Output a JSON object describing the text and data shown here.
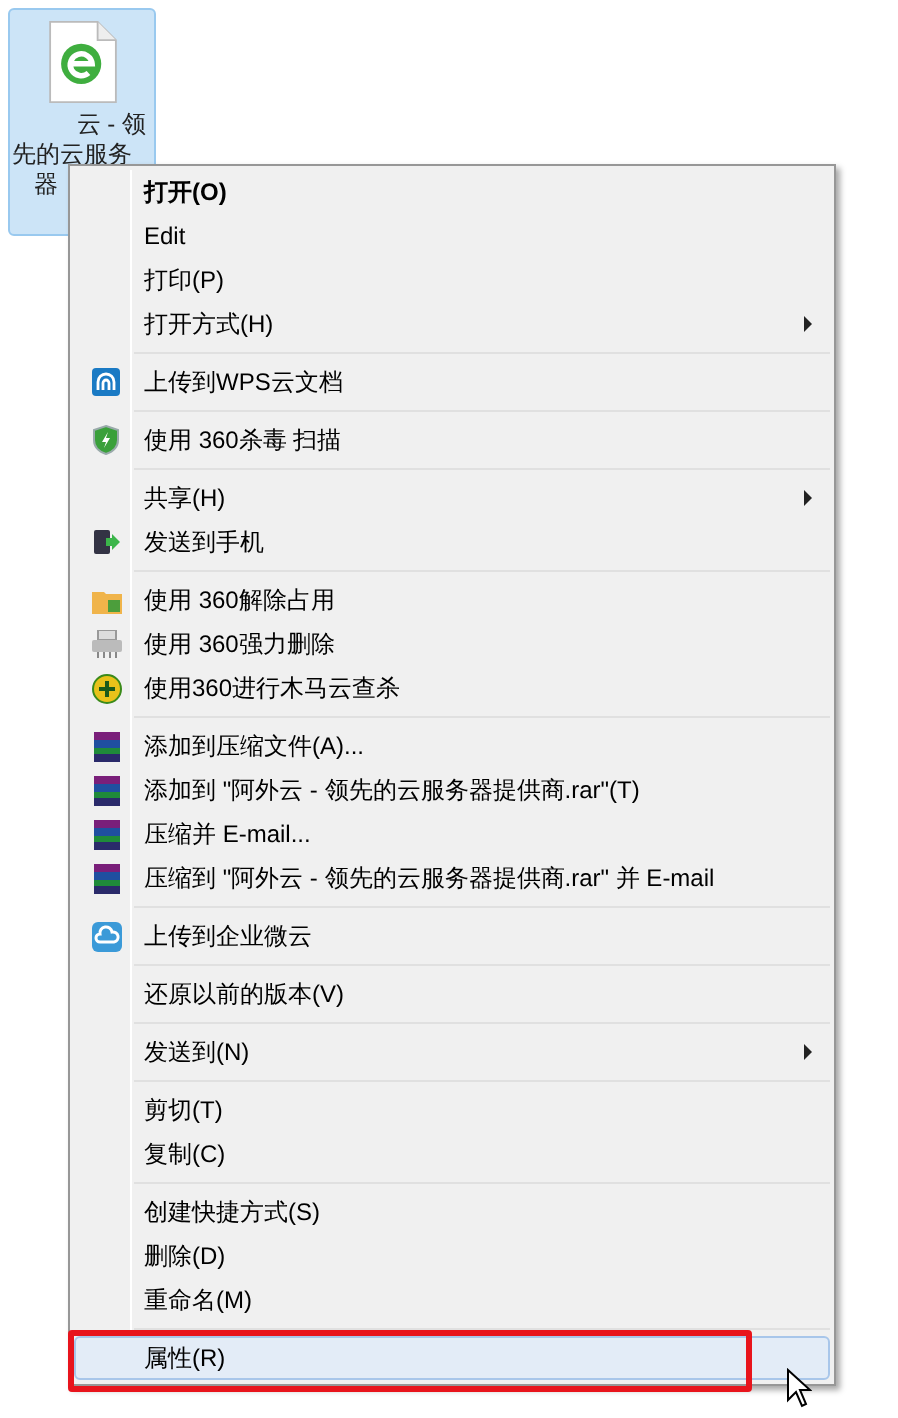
{
  "desktop_icon": {
    "selected": true,
    "label_lines": [
      "云 - 领",
      "先的云服务",
      "器"
    ]
  },
  "context_menu": {
    "groups": [
      {
        "items": [
          {
            "label": "打开(O)",
            "kind": "default",
            "submenu": false,
            "selected": false
          },
          {
            "label": "Edit",
            "kind": "command",
            "submenu": false,
            "selected": false
          },
          {
            "label": "打印(P)",
            "kind": "command",
            "submenu": false,
            "selected": false
          },
          {
            "label": "打开方式(H)",
            "kind": "command",
            "submenu": true,
            "selected": false
          }
        ]
      },
      {
        "items": [
          {
            "label": "上传到WPS云文档",
            "kind": "command",
            "submenu": false,
            "selected": false
          }
        ]
      },
      {
        "items": [
          {
            "label": "使用 360杀毒 扫描",
            "kind": "command",
            "submenu": false,
            "selected": false
          }
        ]
      },
      {
        "items": [
          {
            "label": "共享(H)",
            "kind": "command",
            "submenu": true,
            "selected": false
          },
          {
            "label": "发送到手机",
            "kind": "command",
            "submenu": false,
            "selected": false
          }
        ]
      },
      {
        "items": [
          {
            "label": "使用 360解除占用",
            "kind": "command",
            "submenu": false,
            "selected": false
          },
          {
            "label": "使用 360强力删除",
            "kind": "command",
            "submenu": false,
            "selected": false
          },
          {
            "label": "使用360进行木马云查杀",
            "kind": "command",
            "submenu": false,
            "selected": false
          }
        ]
      },
      {
        "items": [
          {
            "label": "添加到压缩文件(A)...",
            "kind": "command",
            "submenu": false,
            "selected": false
          },
          {
            "label": "添加到 \"阿外云 - 领先的云服务器提供商.rar\"(T)",
            "kind": "command",
            "submenu": false,
            "selected": false
          },
          {
            "label": "压缩并 E-mail...",
            "kind": "command",
            "submenu": false,
            "selected": false
          },
          {
            "label": "压缩到 \"阿外云 - 领先的云服务器提供商.rar\" 并 E-mail",
            "kind": "command",
            "submenu": false,
            "selected": false
          }
        ]
      },
      {
        "items": [
          {
            "label": "上传到企业微云",
            "kind": "command",
            "submenu": false,
            "selected": false
          }
        ]
      },
      {
        "items": [
          {
            "label": "还原以前的版本(V)",
            "kind": "command",
            "submenu": false,
            "selected": false
          }
        ]
      },
      {
        "items": [
          {
            "label": "发送到(N)",
            "kind": "command",
            "submenu": true,
            "selected": false
          }
        ]
      },
      {
        "items": [
          {
            "label": "剪切(T)",
            "kind": "command",
            "submenu": false,
            "selected": false
          },
          {
            "label": "复制(C)",
            "kind": "command",
            "submenu": false,
            "selected": false
          }
        ]
      },
      {
        "items": [
          {
            "label": "创建快捷方式(S)",
            "kind": "command",
            "submenu": false,
            "selected": false
          },
          {
            "label": "删除(D)",
            "kind": "command",
            "submenu": false,
            "selected": false
          },
          {
            "label": "重命名(M)",
            "kind": "command",
            "submenu": false,
            "selected": false
          }
        ]
      },
      {
        "items": [
          {
            "label": "属性(R)",
            "kind": "command",
            "submenu": false,
            "selected": true
          }
        ]
      }
    ]
  }
}
